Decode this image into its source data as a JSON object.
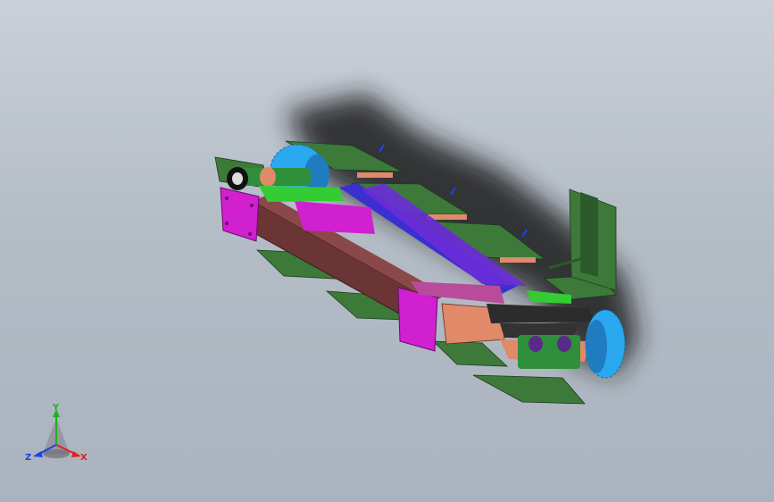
{
  "viewport": {
    "background": "#b8bfc9"
  },
  "model": {
    "colors": {
      "frame_brown": "#6b3535",
      "frame_dark": "#4a2424",
      "plate_magenta": "#d020d0",
      "rail_blue": "#3b2fd0",
      "rail_purple": "#6a2cd8",
      "slat_green": "#3d7a3a",
      "slat_green_dark": "#2c5a2a",
      "sprocket_cyan": "#2aa8f0",
      "bracket_salmon": "#e08a6a",
      "bright_green": "#33cc33"
    }
  },
  "triad": {
    "x_label": "X",
    "y_label": "Y",
    "z_label": "Z",
    "x_color": "#e02020",
    "y_color": "#20b020",
    "z_color": "#2040e0"
  }
}
